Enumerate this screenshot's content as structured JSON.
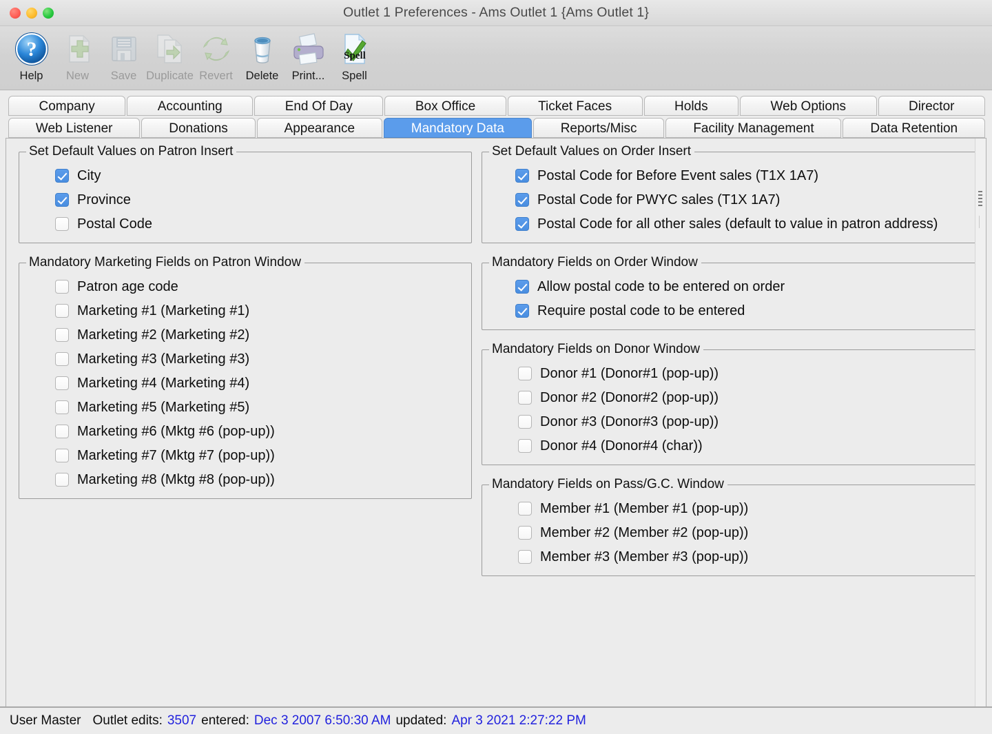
{
  "window": {
    "title": "Outlet 1 Preferences - Ams Outlet 1 {Ams Outlet 1}",
    "traffic": {
      "close": "close-button",
      "minimize": "minimize-button",
      "maximize": "maximize-button"
    }
  },
  "toolbar": {
    "items": [
      {
        "label": "Help",
        "icon": "help-icon",
        "disabled": false
      },
      {
        "label": "New",
        "icon": "new-icon",
        "disabled": true
      },
      {
        "label": "Save",
        "icon": "save-icon",
        "disabled": true
      },
      {
        "label": "Duplicate",
        "icon": "duplicate-icon",
        "disabled": true
      },
      {
        "label": "Revert",
        "icon": "revert-icon",
        "disabled": true
      },
      {
        "label": "Delete",
        "icon": "delete-icon",
        "disabled": false
      },
      {
        "label": "Print...",
        "icon": "print-icon",
        "disabled": false
      },
      {
        "label": "Spell",
        "icon": "spell-icon",
        "disabled": false
      }
    ]
  },
  "tabs": {
    "active": "Mandatory Data",
    "row1": [
      "Company",
      "Accounting",
      "End Of Day",
      "Box Office",
      "Ticket Faces",
      "Holds",
      "Web Options",
      "Director"
    ],
    "row2": [
      "Web Listener",
      "Donations",
      "Appearance",
      "Mandatory Data",
      "Reports/Misc",
      "Facility Management",
      "Data Retention"
    ]
  },
  "groups": {
    "patron_insert": {
      "legend": "Set Default Values on Patron Insert",
      "items": [
        {
          "label": "City",
          "checked": true
        },
        {
          "label": "Province",
          "checked": true
        },
        {
          "label": "Postal Code",
          "checked": false
        }
      ]
    },
    "marketing_fields": {
      "legend": "Mandatory Marketing Fields on Patron Window",
      "items": [
        {
          "label": "Patron age code",
          "checked": false
        },
        {
          "label": "Marketing #1 (Marketing #1)",
          "checked": false
        },
        {
          "label": "Marketing #2 (Marketing #2)",
          "checked": false
        },
        {
          "label": "Marketing #3 (Marketing #3)",
          "checked": false
        },
        {
          "label": "Marketing #4 (Marketing #4)",
          "checked": false
        },
        {
          "label": "Marketing #5 (Marketing #5)",
          "checked": false
        },
        {
          "label": "Marketing #6 (Mktg #6 (pop-up))",
          "checked": false
        },
        {
          "label": "Marketing #7 (Mktg #7 (pop-up))",
          "checked": false
        },
        {
          "label": "Marketing #8 (Mktg #8 (pop-up))",
          "checked": false
        }
      ]
    },
    "order_insert": {
      "legend": "Set Default Values on Order Insert",
      "items": [
        {
          "label": "Postal Code for Before Event sales (T1X 1A7)",
          "checked": true
        },
        {
          "label": "Postal Code for PWYC sales (T1X 1A7)",
          "checked": true
        },
        {
          "label": "Postal Code for all other sales (default to value in patron address)",
          "checked": true
        }
      ]
    },
    "order_window": {
      "legend": "Mandatory Fields on Order Window",
      "items": [
        {
          "label": "Allow postal code to be entered on order",
          "checked": true
        },
        {
          "label": "Require postal code to be entered",
          "checked": true
        }
      ]
    },
    "donor_window": {
      "legend": "Mandatory Fields on Donor Window",
      "items": [
        {
          "label": "Donor #1 (Donor#1 (pop-up))",
          "checked": false
        },
        {
          "label": "Donor #2 (Donor#2 (pop-up))",
          "checked": false
        },
        {
          "label": "Donor #3 (Donor#3 (pop-up))",
          "checked": false
        },
        {
          "label": "Donor #4 (Donor#4 (char))",
          "checked": false
        }
      ]
    },
    "pass_gc_window": {
      "legend": "Mandatory Fields on Pass/G.C. Window",
      "items": [
        {
          "label": "Member #1 (Member #1 (pop-up))",
          "checked": false
        },
        {
          "label": "Member #2 (Member #2 (pop-up))",
          "checked": false
        },
        {
          "label": "Member #3 (Member #3 (pop-up))",
          "checked": false
        }
      ]
    }
  },
  "statusbar": {
    "user": "User Master",
    "edits_label": "Outlet edits:",
    "edits_value": "3507",
    "entered_label": "entered:",
    "entered_value": "Dec 3 2007 6:50:30 AM",
    "updated_label": "updated:",
    "updated_value": "Apr 3 2021 2:27:22 PM"
  },
  "colors": {
    "accent": "#5b9ceb",
    "status_link": "#2222dd",
    "window_bg": "#ececec"
  }
}
